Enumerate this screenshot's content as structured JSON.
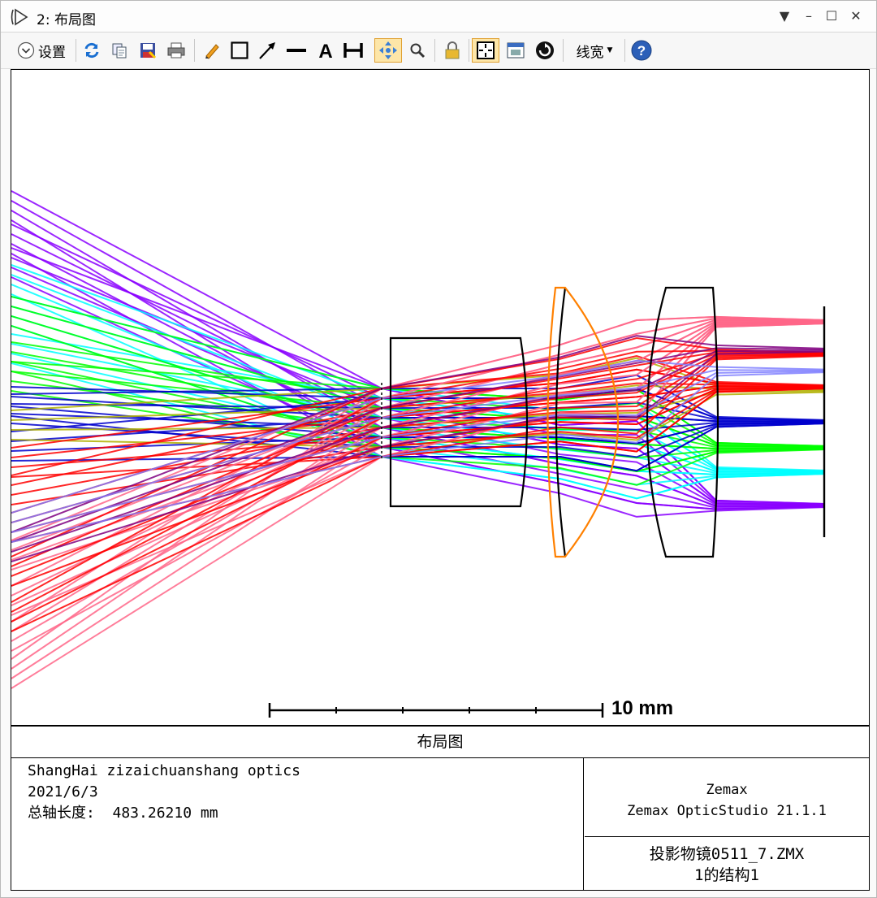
{
  "window": {
    "title": "2: 布局图"
  },
  "toolbar": {
    "settings_label": "设置",
    "linewidth_label": "线宽",
    "icons": [
      "refresh-icon",
      "copy-icon",
      "save-icon",
      "print-icon",
      "pencil-icon",
      "rectangle-icon",
      "arrow-icon",
      "line-icon",
      "text-icon",
      "dimension-icon",
      "pan-icon",
      "zoom-icon",
      "lock-icon",
      "fit-icon",
      "window-icon",
      "rotate-icon",
      "help-icon"
    ]
  },
  "plot": {
    "scale_bar_label": "10 mm",
    "ray_colors": [
      "#8a00ff",
      "#ff0000",
      "#0000cc",
      "#00ff00",
      "#00ffff",
      "#ff6688",
      "#b0b000",
      "#800080",
      "#8080ff"
    ],
    "lens_color": "#000000",
    "highlight_lens_color": "#ff8000"
  },
  "info": {
    "title": "布局图",
    "left_lines": [
      "ShangHai zizaichuanshang optics",
      "2021/6/3",
      "总轴长度:  483.26210 mm"
    ],
    "right_top_lines": [
      "Zemax",
      "Zemax OpticStudio 21.1.1"
    ],
    "right_bottom_lines": [
      "投影物镜0511_7.ZMX",
      "1的结构1"
    ]
  }
}
